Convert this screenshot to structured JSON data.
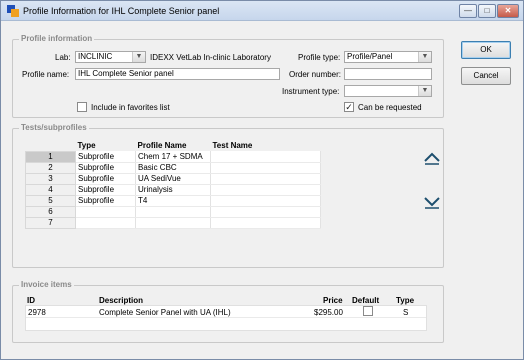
{
  "window": {
    "title": "Profile Information for IHL Complete Senior panel"
  },
  "window_controls": {
    "minimize": "—",
    "maximize": "□",
    "close": "✕"
  },
  "profile_info": {
    "section_title": "Profile information",
    "lab_label": "Lab:",
    "lab_value": "INCLINIC",
    "lab_description": "IDEXX VetLab In-clinic Laboratory",
    "profile_type_label": "Profile type:",
    "profile_type_value": "Profile/Panel",
    "profile_name_label": "Profile name:",
    "profile_name_value": "IHL Complete Senior panel",
    "order_number_label": "Order number:",
    "order_number_value": "",
    "instrument_type_label": "Instrument type:",
    "instrument_type_value": "",
    "favorites_label": "Include in favorites list",
    "favorites_checked": false,
    "requested_label": "Can be requested",
    "requested_checked": true
  },
  "tests": {
    "section_title": "Tests/subprofiles",
    "columns": [
      "Type",
      "Profile Name",
      "Test Name"
    ],
    "rows": [
      {
        "num": "1",
        "type": "Subprofile",
        "profile": "Chem 17 + SDMA",
        "test": ""
      },
      {
        "num": "2",
        "type": "Subprofile",
        "profile": "Basic CBC",
        "test": ""
      },
      {
        "num": "3",
        "type": "Subprofile",
        "profile": "UA SediVue",
        "test": ""
      },
      {
        "num": "4",
        "type": "Subprofile",
        "profile": "Urinalysis",
        "test": ""
      },
      {
        "num": "5",
        "type": "Subprofile",
        "profile": "T4",
        "test": ""
      },
      {
        "num": "6",
        "type": "",
        "profile": "",
        "test": ""
      },
      {
        "num": "7",
        "type": "",
        "profile": "",
        "test": ""
      }
    ],
    "move_up_icon": "move-up-arrow",
    "move_down_icon": "move-down-arrow"
  },
  "invoice": {
    "section_title": "Invoice items",
    "columns": {
      "id": "ID",
      "description": "Description",
      "price": "Price",
      "default": "Default",
      "type": "Type"
    },
    "rows": [
      {
        "id": "2978",
        "description": "Complete Senior Panel with UA (IHL)",
        "price": "$295.00",
        "default": false,
        "type": "S"
      }
    ]
  },
  "buttons": {
    "ok": "OK",
    "cancel": "Cancel"
  },
  "colors": {
    "title_bar": "#c6d6ec",
    "app_icon_blue": "#1e4fb8",
    "app_icon_orange": "#f0a020",
    "selected_row_header": "#c9c9c9"
  }
}
